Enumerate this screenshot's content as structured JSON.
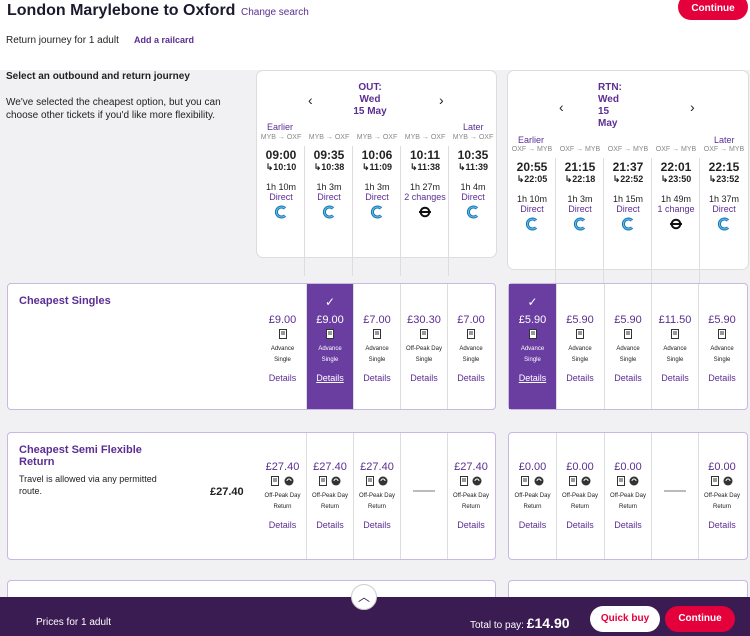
{
  "header": {
    "title": "London Marylebone to Oxford",
    "change_search": "Change search",
    "subtitle": "Return journey for 1 adult",
    "add_railcard": "Add a railcard",
    "continue": "Continue"
  },
  "intro": {
    "heading": "Select an outbound and return journey",
    "text": "We've selected the cheapest option, but you can choose other tickets if you'd like more flexibility."
  },
  "out": {
    "label": "OUT:",
    "day": "Wed",
    "date": "15 May",
    "earlier": "Earlier",
    "later": "Later",
    "times": [
      {
        "route": "MYB → OXF",
        "dep": "09:00",
        "arr": "↳10:10",
        "dur": "1h 10m",
        "changes": "Direct",
        "icon": "chiltern-icon"
      },
      {
        "route": "MYB → OXF",
        "dep": "09:35",
        "arr": "↳10:38",
        "dur": "1h 3m",
        "changes": "Direct",
        "icon": "chiltern-icon"
      },
      {
        "route": "MYB → OXF",
        "dep": "10:06",
        "arr": "↳11:09",
        "dur": "1h 3m",
        "changes": "Direct",
        "icon": "chiltern-icon"
      },
      {
        "route": "MYB → OXF",
        "dep": "10:11",
        "arr": "↳11:38",
        "dur": "1h 27m",
        "changes": "2 changes",
        "icon": "underground-icon"
      },
      {
        "route": "MYB → OXF",
        "dep": "10:35",
        "arr": "↳11:39",
        "dur": "1h 4m",
        "changes": "Direct",
        "icon": "chiltern-icon"
      }
    ]
  },
  "rtn": {
    "label": "RTN:",
    "day": "Wed",
    "date1": "15",
    "date2": "May",
    "earlier": "Earlier",
    "later": "Later",
    "times": [
      {
        "route": "OXF → MYB",
        "dep": "20:55",
        "arr": "↳22:05",
        "dur": "1h 10m",
        "changes": "Direct",
        "icon": "chiltern-icon"
      },
      {
        "route": "OXF → MYB",
        "dep": "21:15",
        "arr": "↳22:18",
        "dur": "1h 3m",
        "changes": "Direct",
        "icon": "chiltern-icon"
      },
      {
        "route": "OXF → MYB",
        "dep": "21:37",
        "arr": "↳22:52",
        "dur": "1h 15m",
        "changes": "Direct",
        "icon": "chiltern-icon"
      },
      {
        "route": "OXF → MYB",
        "dep": "22:01",
        "arr": "↳23:50",
        "dur": "1h 49m",
        "changes": "1 change",
        "icon": "underground-icon"
      },
      {
        "route": "OXF → MYB",
        "dep": "22:15",
        "arr": "↳23:52",
        "dur": "1h 37m",
        "changes": "Direct",
        "icon": "chiltern-icon"
      }
    ]
  },
  "singles": {
    "title": "Cheapest Singles",
    "check": "✓",
    "out": [
      {
        "price": "£9.00",
        "t1": "Advance",
        "t2": "Single"
      },
      {
        "price": "£9.00",
        "t1": "Advance",
        "t2": "Single"
      },
      {
        "price": "£7.00",
        "t1": "Advance",
        "t2": "Single"
      },
      {
        "price": "£30.30",
        "t1": "Off-Peak Day",
        "t2": "Single"
      },
      {
        "price": "£7.00",
        "t1": "Advance",
        "t2": "Single"
      }
    ],
    "rtn": [
      {
        "price": "£5.90",
        "t1": "Advance",
        "t2": "Single"
      },
      {
        "price": "£5.90",
        "t1": "Advance",
        "t2": "Single"
      },
      {
        "price": "£5.90",
        "t1": "Advance",
        "t2": "Single"
      },
      {
        "price": "£11.50",
        "t1": "Advance",
        "t2": "Single"
      },
      {
        "price": "£5.90",
        "t1": "Advance",
        "t2": "Single"
      }
    ]
  },
  "semi": {
    "title1": "Cheapest Semi Flexible",
    "title2": "Return",
    "desc1": "Travel is allowed via any permitted",
    "desc2": "route.",
    "price": "£27.40",
    "out": [
      {
        "price": "£27.40",
        "t1": "Off-Peak Day",
        "t2": "Return"
      },
      {
        "price": "£27.40",
        "t1": "Off-Peak Day",
        "t2": "Return"
      },
      {
        "price": "£27.40",
        "t1": "Off-Peak Day",
        "t2": "Return"
      },
      null,
      {
        "price": "£27.40",
        "t1": "Off-Peak Day",
        "t2": "Return"
      }
    ],
    "rtn": [
      {
        "price": "£0.00",
        "t1": "Off-Peak Day",
        "t2": "Return"
      },
      {
        "price": "£0.00",
        "t1": "Off-Peak Day",
        "t2": "Return"
      },
      {
        "price": "£0.00",
        "t1": "Off-Peak Day",
        "t2": "Return"
      },
      null,
      {
        "price": "£0.00",
        "t1": "Off-Peak Day",
        "t2": "Return"
      }
    ]
  },
  "details": "Details",
  "footer": {
    "prices_for": "Prices for 1 adult",
    "total_label": "Total to pay:",
    "total": "£14.90",
    "quick_buy": "Quick buy",
    "continue": "Continue"
  },
  "colors": {
    "brand": "#5b2e91",
    "accent": "#e4003b",
    "footer": "#3a1b52"
  }
}
